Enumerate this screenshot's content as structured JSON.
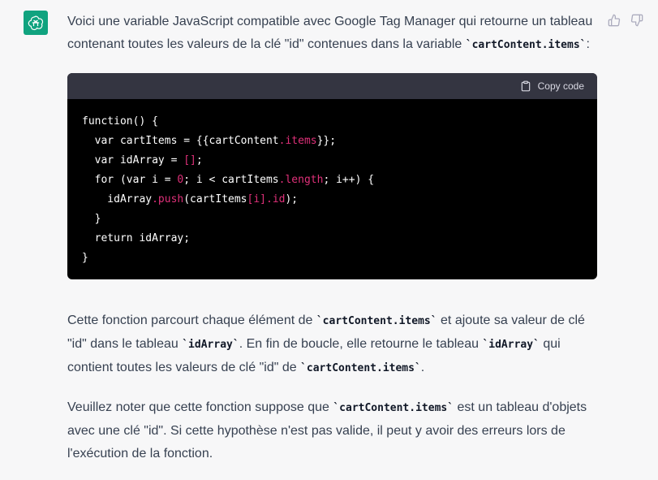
{
  "avatar": {
    "icon": "openai-logo-icon",
    "color": "#10a37f"
  },
  "actions": {
    "thumbs_up_icon": "thumbs-up-icon",
    "thumbs_down_icon": "thumbs-down-icon"
  },
  "message": {
    "intro_a": "Voici une variable JavaScript compatible avec Google Tag Manager qui retourne un tableau contenant toutes les valeurs de la clé \"id\" contenues dans la variable ",
    "intro_code": "`cartContent.items`",
    "intro_b": ":",
    "code_block": {
      "copy_label": "Copy code",
      "lines": [
        [
          {
            "t": "function() {",
            "c": ""
          }
        ],
        [
          {
            "t": "  var cartItems = {{cartContent",
            "c": ""
          },
          {
            "t": ".items",
            "c": "prop"
          },
          {
            "t": "}};",
            "c": ""
          }
        ],
        [
          {
            "t": "  var idArray = ",
            "c": ""
          },
          {
            "t": "[]",
            "c": "prop"
          },
          {
            "t": ";",
            "c": ""
          }
        ],
        [
          {
            "t": "  for (var i = ",
            "c": ""
          },
          {
            "t": "0",
            "c": "num"
          },
          {
            "t": "; i < cartItems",
            "c": ""
          },
          {
            "t": ".length",
            "c": "prop"
          },
          {
            "t": "; i++) {",
            "c": ""
          }
        ],
        [
          {
            "t": "    idArray",
            "c": ""
          },
          {
            "t": ".push",
            "c": "prop"
          },
          {
            "t": "(cartItems",
            "c": ""
          },
          {
            "t": "[i]",
            "c": "prop"
          },
          {
            "t": ".id",
            "c": "prop"
          },
          {
            "t": ");",
            "c": ""
          }
        ],
        [
          {
            "t": "  }",
            "c": ""
          }
        ],
        [
          {
            "t": "  return idArray;",
            "c": ""
          }
        ],
        [
          {
            "t": "}",
            "c": ""
          }
        ]
      ]
    },
    "para1": {
      "s1": "Cette fonction parcourt chaque élément de ",
      "c1": "`cartContent.items`",
      "s2": " et ajoute sa valeur de clé \"id\" dans le tableau ",
      "c2": "`idArray`",
      "s3": ". En fin de boucle, elle retourne le tableau ",
      "c3": "`idArray`",
      "s4": " qui contient toutes les valeurs de clé \"id\" de ",
      "c4": "`cartContent.items`",
      "s5": "."
    },
    "para2": {
      "s1": "Veuillez noter que cette fonction suppose que ",
      "c1": "`cartContent.items`",
      "s2": " est un tableau d'objets avec une clé \"id\". Si cette hypothèse n'est pas valide, il peut y avoir des erreurs lors de l'exécution de la fonction."
    }
  },
  "colors": {
    "code_prop": "#df3079",
    "code_bg": "#000000",
    "code_header": "#343541",
    "page_bg": "#f7f7f8"
  }
}
